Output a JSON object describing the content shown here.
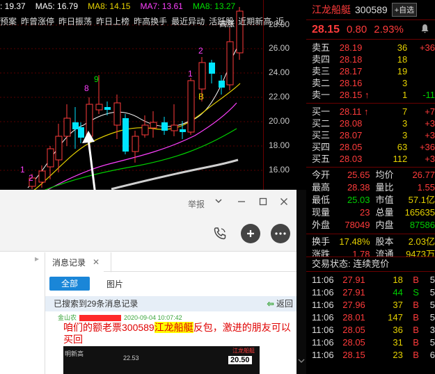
{
  "ma_legend": [
    {
      "label": ": 19.37",
      "color": "#ffffff"
    },
    {
      "label": "MA5: 16.79",
      "color": "#ffffff"
    },
    {
      "label": "MA8: 14.15",
      "color": "#e6d200"
    },
    {
      "label": "MA7: 13.61",
      "color": "#ff40ff"
    },
    {
      "label": "MA8: 13.27",
      "color": "#00e000"
    }
  ],
  "func_bar": [
    "预案",
    "昨曾涨停",
    "昨日振荡",
    "昨日上榜",
    "昨高换手",
    "最近异动",
    "活跃股",
    "近期新高",
    "近"
  ],
  "price_ticks": [
    "28.00",
    "26.00",
    "24.00",
    "22.00",
    "20.00",
    "18.00",
    "16.00"
  ],
  "chart_labels": {
    "nine_a": "9",
    "eight": "8",
    "two_top": "2",
    "one_mid": "1",
    "b_mark": "B",
    "one_left": "1",
    "two_left": "2",
    "high_marker": "高涨"
  },
  "quote": {
    "name": "江龙船艇",
    "code": "300589",
    "add_button": "自选",
    "price": "28.15",
    "change": "0.80",
    "change_pct": "2.93%",
    "asks": [
      {
        "label": "卖五",
        "price": "28.19",
        "vol": "36",
        "chg": "+36"
      },
      {
        "label": "卖四",
        "price": "28.18",
        "vol": "18",
        "chg": ""
      },
      {
        "label": "卖三",
        "price": "28.17",
        "vol": "19",
        "chg": ""
      },
      {
        "label": "卖二",
        "price": "28.16",
        "vol": "3",
        "chg": ""
      },
      {
        "label": "卖一",
        "price": "28.15",
        "vol": "1",
        "chg": "-11"
      }
    ],
    "bids": [
      {
        "label": "买一",
        "price": "28.11",
        "vol": "7",
        "chg": "+7"
      },
      {
        "label": "买二",
        "price": "28.08",
        "vol": "3",
        "chg": "+3"
      },
      {
        "label": "买三",
        "price": "28.07",
        "vol": "3",
        "chg": "+3"
      },
      {
        "label": "买四",
        "price": "28.05",
        "vol": "63",
        "chg": "+36"
      },
      {
        "label": "买五",
        "price": "28.03",
        "vol": "112",
        "chg": "+3"
      }
    ],
    "stats": [
      {
        "k1": "今开",
        "v1": "25.65",
        "k2": "均价",
        "v2": "26.77"
      },
      {
        "k1": "最高",
        "v1": "28.38",
        "k2": "量比",
        "v2": "1.55"
      },
      {
        "k1": "最低",
        "v1": "25.03",
        "k2": "市值",
        "v2": "57.1亿"
      },
      {
        "k1": "现量",
        "v1": "23",
        "k2": "总量",
        "v2": "165635"
      },
      {
        "k1": "外盘",
        "v1": "78049",
        "k2": "内盘",
        "v2": "87586"
      }
    ],
    "stats2": [
      {
        "k1": "换手",
        "v1": "17.48%",
        "k2": "股本",
        "v2": "2.03亿"
      },
      {
        "k1": "涨跌",
        "v1": "1.78",
        "k2": "流通",
        "v2": "9473万"
      }
    ],
    "trade_status": "交易状态: 连续竞价",
    "trades": [
      {
        "t": "11:06",
        "p": "27.91",
        "v": "18",
        "s": "B",
        "n": "5"
      },
      {
        "t": "11:06",
        "p": "27.91",
        "v": "44",
        "s": "S",
        "n": "5"
      },
      {
        "t": "11:06",
        "p": "27.96",
        "v": "37",
        "s": "B",
        "n": "5"
      },
      {
        "t": "11:06",
        "p": "28.01",
        "v": "147",
        "s": "B",
        "n": "5"
      },
      {
        "t": "11:06",
        "p": "28.05",
        "v": "36",
        "s": "B",
        "n": "3"
      },
      {
        "t": "11:06",
        "p": "28.05",
        "v": "31",
        "s": "B",
        "n": "5"
      },
      {
        "t": "11:06",
        "p": "28.15",
        "v": "23",
        "s": "B",
        "n": "6"
      }
    ]
  },
  "chat": {
    "report": "举报",
    "history_tab": "消息记录",
    "all_btn": "全部",
    "pic_btn": "图片",
    "search_result": "已搜索到29条消息记录",
    "back": "返回",
    "sender": "金山农",
    "timestamp": "2020-09-04 10:07:42",
    "message_pre": "咱们的额老票300589",
    "message_highlight": "江龙船艇",
    "message_post": "反包，激进的朋友可以买回",
    "img_text1": "22.53",
    "img_text2": "20.50",
    "img_text3": "江龙船艇",
    "img_text4": "明新高"
  },
  "colors": {
    "up": "#ff3b3b",
    "down": "#00d000",
    "accent": "#1a86d8"
  }
}
